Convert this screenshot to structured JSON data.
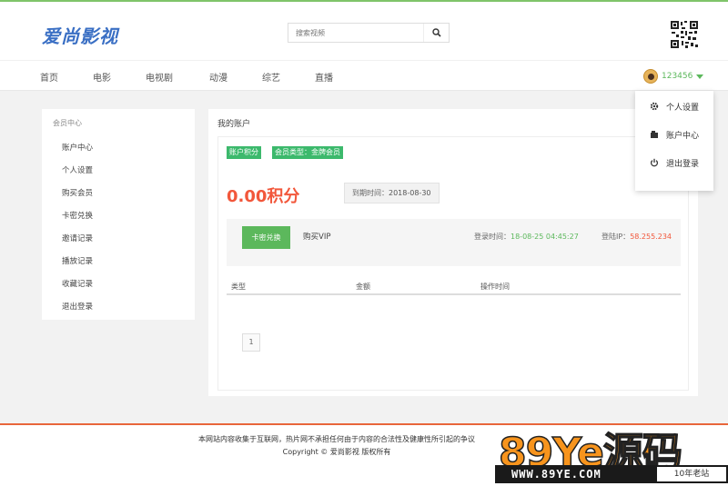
{
  "header": {
    "logo_text": "爱尚影视",
    "search_placeholder": "搜索视频"
  },
  "nav": {
    "items": [
      "首页",
      "电影",
      "电视剧",
      "动漫",
      "综艺",
      "直播"
    ],
    "username": "123456"
  },
  "user_menu": {
    "items": [
      {
        "label": "个人设置",
        "icon": "gear-icon"
      },
      {
        "label": "账户中心",
        "icon": "account-icon"
      },
      {
        "label": "退出登录",
        "icon": "power-icon"
      }
    ]
  },
  "sidebar": {
    "title": "会员中心",
    "items": [
      "账户中心",
      "个人设置",
      "购买会员",
      "卡密兑换",
      "邀请记录",
      "播放记录",
      "收藏记录",
      "退出登录"
    ]
  },
  "account": {
    "title": "我的账户",
    "badge_points": "账户积分",
    "badge_member": "会员类型：金牌会员",
    "points": "0.00积分",
    "expiry_label": "到期时间：",
    "expiry_value": "2018-08-30",
    "redeem_button": "卡密兑换",
    "buy_vip_button": "购买VIP",
    "login_time_label": "登录时间：",
    "login_time_value": "18-08-25 04:45:27",
    "login_ip_label": "登陆IP：",
    "login_ip_value": "58.255.234",
    "table_headers": [
      "类型",
      "金额",
      "操作时间"
    ],
    "page_number": "1"
  },
  "footer": {
    "line1": "本网站内容收集于互联网，热片网不承担任何由于内容的合法性及健康性所引起的争议",
    "line2": "Copyright © 爱尚影视 版权所有"
  },
  "watermark": {
    "brand": "89Ye源码",
    "url": "WWW.89YE.COM",
    "tag": "10年老站"
  },
  "colors": {
    "accent_green": "#5cb85c",
    "badge_green": "#3cb96c",
    "points_red": "#f2573b",
    "footer_orange": "#e8663b",
    "logo_blue": "#3a6fc4"
  }
}
